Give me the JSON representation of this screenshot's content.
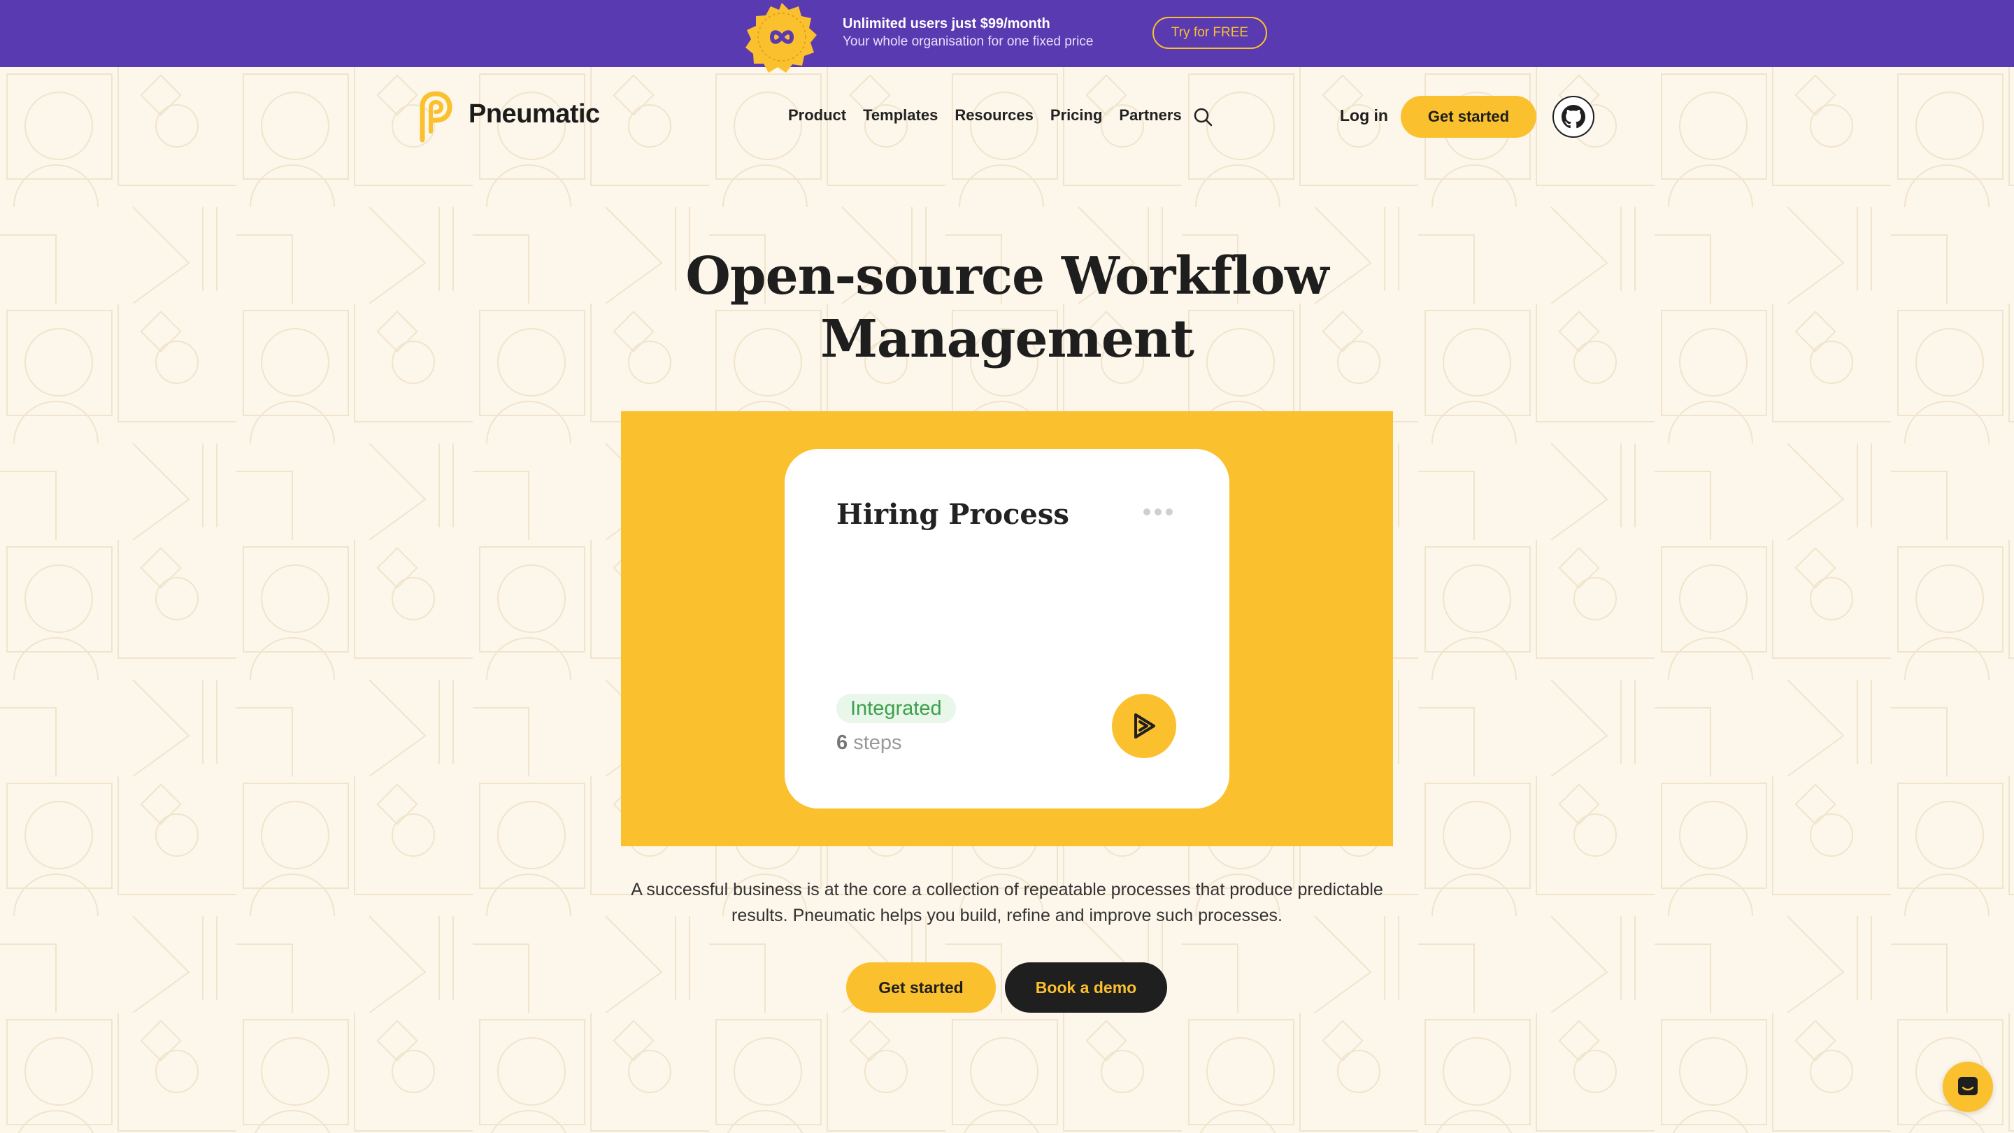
{
  "promo": {
    "title": "Unlimited users just $99/month",
    "subtitle": "Your whole organisation for one fixed price",
    "button": "Try for FREE",
    "badge_icon": "infinity-icon"
  },
  "header": {
    "logo_text": "Pneumatic",
    "nav": [
      "Product",
      "Templates",
      "Resources",
      "Pricing",
      "Partners"
    ],
    "login": "Log in",
    "cta": "Get started",
    "icons": {
      "search": "search-icon",
      "github": "github-icon"
    }
  },
  "hero": {
    "title_line1": "Open-source Workflow",
    "title_line2": "Management",
    "card": {
      "title": "Hiring Process",
      "badge": "Integrated",
      "steps_count": "6",
      "steps_label": "steps"
    },
    "description": "A successful business is at the core a collection of repeatable processes that produce predictable results. Pneumatic helps you build, refine and improve such processes.",
    "primary_cta": "Get started",
    "secondary_cta": "Book a demo"
  },
  "colors": {
    "accent": "#fbc02d",
    "banner": "#5a3ab0",
    "background": "#fdf6ea",
    "dark": "#1f1f1f",
    "badge_green": "#3da14b"
  }
}
